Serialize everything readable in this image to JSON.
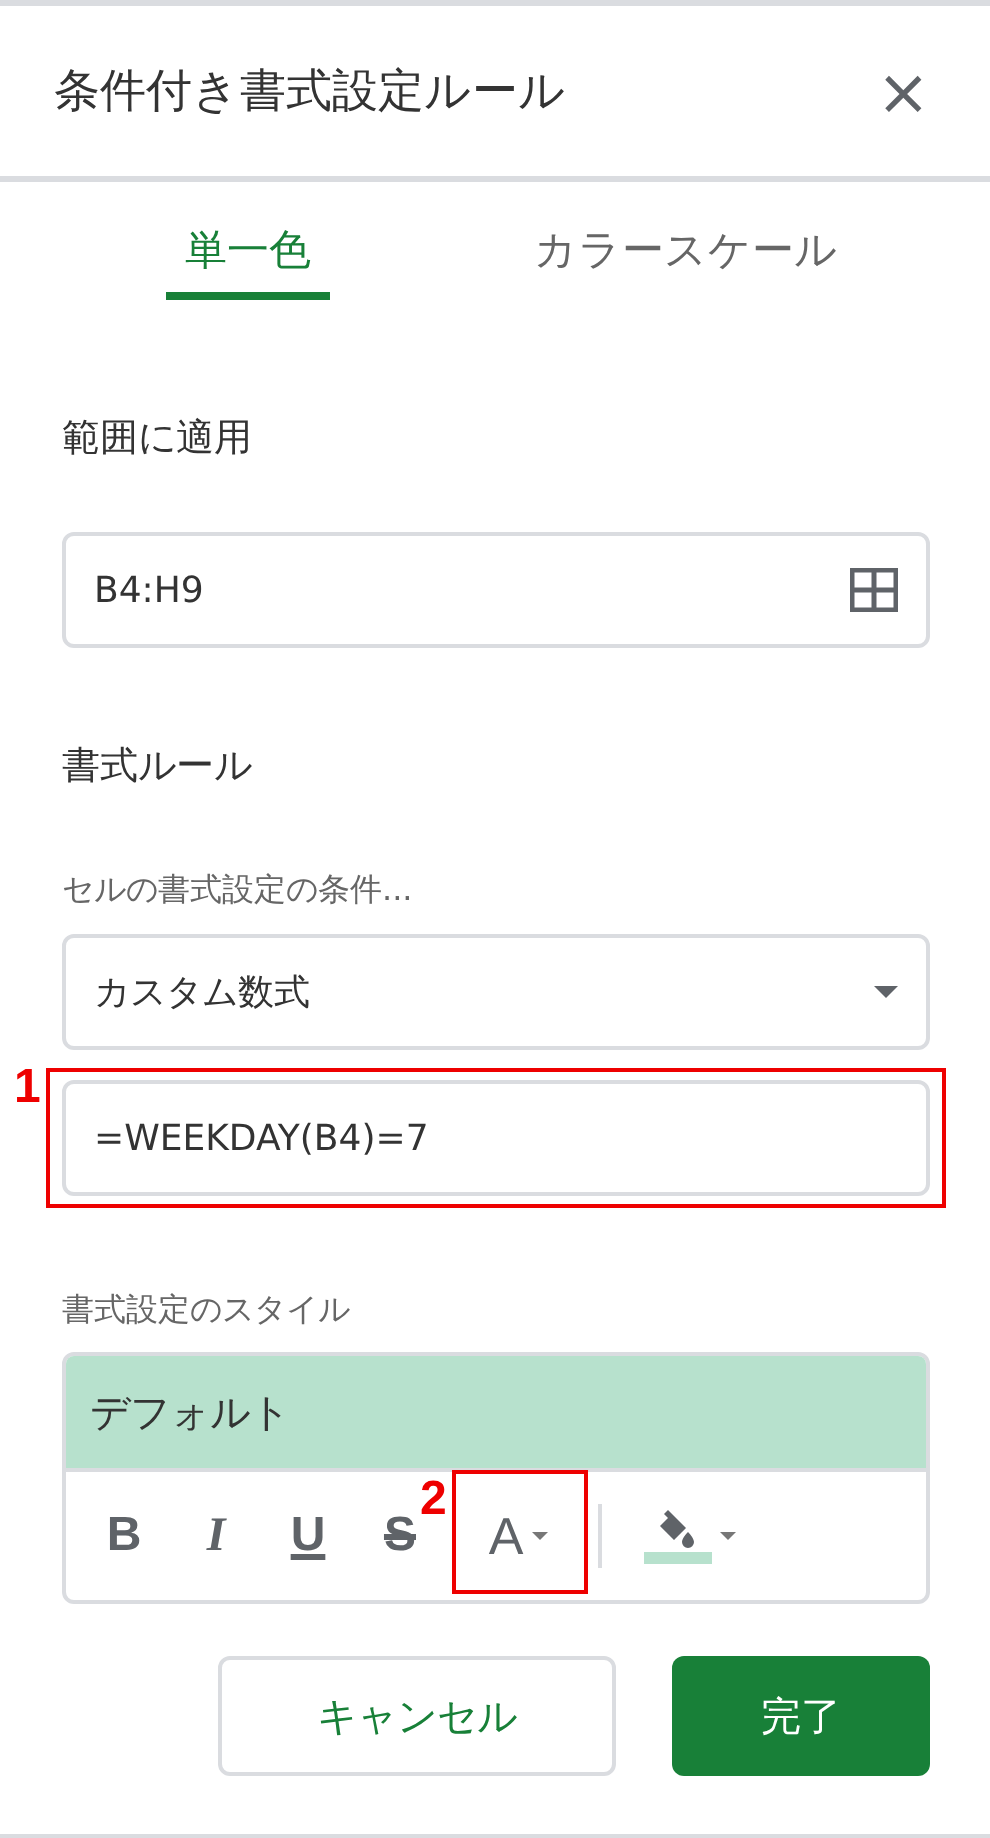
{
  "panel": {
    "title": "条件付き書式設定ルール",
    "close": "×"
  },
  "tabs": [
    {
      "label": "単一色",
      "selected": true
    },
    {
      "label": "カラースケール",
      "selected": false
    }
  ],
  "range": {
    "label": "範囲に適用",
    "value": "B4:H9"
  },
  "rules": {
    "heading": "書式ルール",
    "condition_label": "セルの書式設定の条件...",
    "condition": "カスタム数式",
    "formula": "=WEEKDAY(B4)=7",
    "formula_annotation": "1"
  },
  "style": {
    "label": "書式設定のスタイル",
    "preview": "デフォルト",
    "tools": [
      {
        "kind": "bold",
        "glyph": "B"
      },
      {
        "kind": "italic",
        "glyph": "I"
      },
      {
        "kind": "underline",
        "glyph": "U"
      },
      {
        "kind": "strike",
        "glyph": "S"
      },
      {
        "kind": "text-color",
        "glyph": "A",
        "annotation": "2"
      },
      {
        "kind": "fill-color",
        "color": "#b7e1cd"
      }
    ]
  },
  "buttons": [
    {
      "label": "キャンセル",
      "kind": "secondary"
    },
    {
      "label": "完了",
      "kind": "primary"
    }
  ]
}
